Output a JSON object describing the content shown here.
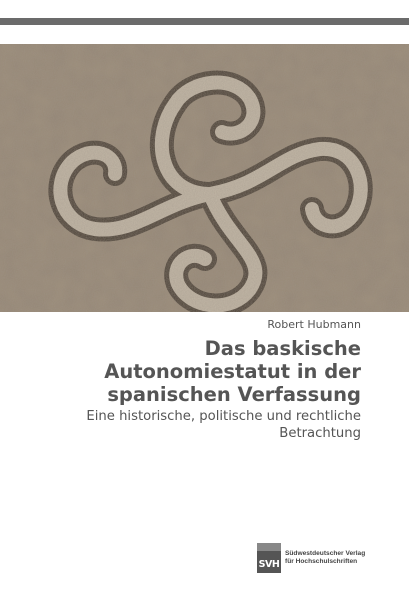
{
  "cover": {
    "image_description_icon": "basque-lauburu-stone-relief",
    "author": "Robert Hubmann",
    "title": "Das baskische Autonomiestatut in der spanischen Verfassung",
    "subtitle": "Eine historische, politische und rechtliche Betrachtung"
  },
  "publisher": {
    "logo_text": "SVH",
    "line1": "Südwestdeutscher Verlag",
    "line2": "für Hochschulschriften"
  },
  "colors": {
    "bar": "#6b6b6b",
    "text": "#555555",
    "stone": "#a0927f"
  }
}
